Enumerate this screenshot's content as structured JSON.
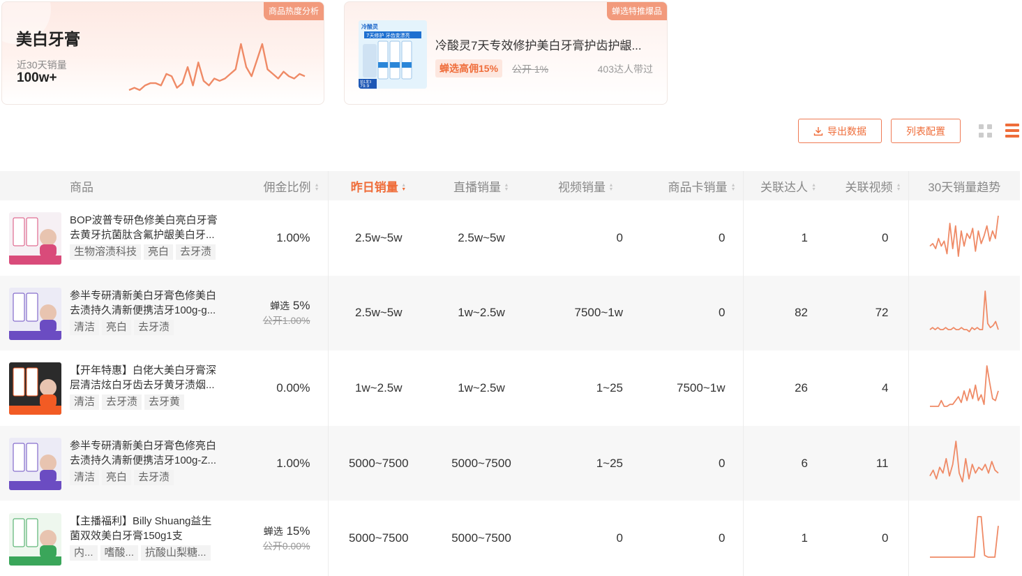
{
  "hot_card": {
    "corner_label": "商品热度分析",
    "title": "美白牙膏",
    "sales_label": "近30天销量",
    "sales_value": "100w+",
    "sparkline": [
      2,
      3,
      2,
      4,
      5,
      5,
      4,
      9,
      8,
      3,
      5,
      12,
      4,
      14,
      6,
      4,
      7,
      6,
      7,
      9,
      11,
      22,
      12,
      8,
      15,
      22,
      11,
      9,
      7,
      10,
      8,
      7,
      9,
      8
    ]
  },
  "featured_card": {
    "corner_label": "蝉选特推爆品",
    "product_name": "冷酸灵7天专效修护美白牙膏护齿护龈...",
    "commission_tag": "蝉选高佣15%",
    "public_commission": "公开 1%",
    "promoter_count": "403达人带过",
    "image_texts": [
      "冷酸灵",
      "7天修护 牙齿变漂亮",
      "拍1发3",
      "79.9"
    ]
  },
  "toolbar": {
    "export_label": "导出数据",
    "config_label": "列表配置"
  },
  "table": {
    "headers": [
      "商品",
      "佣金比例",
      "昨日销量",
      "直播销量",
      "视频销量",
      "商品卡销量",
      "关联达人",
      "关联视频",
      "30天销量趋势"
    ],
    "rows": [
      {
        "title": "BOP波普专研色修美白亮白牙膏去黄牙抗菌肽含氟护龈美白牙...",
        "tags": [
          "生物溶渍科技",
          "亮白",
          "去牙渍"
        ],
        "commission_label": "",
        "commission": "1.00%",
        "commission_old": "",
        "yesterday": "2.5w~5w",
        "live": "2.5w~5w",
        "video": "0",
        "card": "0",
        "influencers": "1",
        "videos": "0",
        "trend": [
          6,
          7,
          5,
          9,
          6,
          8,
          3,
          15,
          5,
          14,
          2,
          12,
          6,
          11,
          9,
          13,
          4,
          12,
          7,
          10,
          14,
          8,
          12,
          9,
          18
        ]
      },
      {
        "title": "参半专研清新美白牙膏色修美白去渍持久清新便携洁牙100g-g...",
        "tags": [
          "清洁",
          "亮白",
          "去牙渍"
        ],
        "commission_label": "蝉选",
        "commission": "5%",
        "commission_old": "公开1.00%",
        "yesterday": "2.5w~5w",
        "live": "1w~2.5w",
        "video": "7500~1w",
        "card": "0",
        "influencers": "82",
        "videos": "72",
        "trend": [
          3,
          4,
          3,
          4,
          3,
          3,
          4,
          3,
          3,
          4,
          3,
          3,
          4,
          3,
          3,
          2,
          4,
          3,
          4,
          3,
          3,
          22,
          6,
          4,
          5,
          7,
          3
        ]
      },
      {
        "title": "【开年特惠】白佬大美白牙膏深层清洁炫白牙齿去牙黄牙渍烟...",
        "tags": [
          "清洁",
          "去牙渍",
          "去牙黄"
        ],
        "commission_label": "",
        "commission": "0.00%",
        "commission_old": "",
        "yesterday": "1w~2.5w",
        "live": "1w~2.5w",
        "video": "1~25",
        "card": "7500~1w",
        "influencers": "26",
        "videos": "4",
        "trend": [
          0,
          0,
          0,
          0,
          3,
          0,
          0,
          1,
          1,
          3,
          5,
          2,
          8,
          3,
          9,
          4,
          11,
          3,
          6,
          1,
          21,
          12,
          4,
          3,
          8
        ]
      },
      {
        "title": "参半专研清新美白牙膏色修亮白去渍持久清新便携洁牙100g-Z...",
        "tags": [
          "清洁",
          "亮白",
          "去牙渍"
        ],
        "commission_label": "",
        "commission": "1.00%",
        "commission_old": "",
        "yesterday": "5000~7500",
        "live": "5000~7500",
        "video": "1~25",
        "card": "0",
        "influencers": "6",
        "videos": "11",
        "trend": [
          6,
          8,
          5,
          9,
          7,
          12,
          6,
          10,
          18,
          7,
          4,
          12,
          5,
          10,
          7,
          9,
          8,
          10,
          7,
          11,
          8,
          7
        ]
      },
      {
        "title": "【主播福利】Billy Shuang益生菌双效美白牙膏150g1支",
        "tags": [
          "内...",
          "嗜酸...",
          "抗酸山梨糖..."
        ],
        "commission_label": "蝉选",
        "commission": "15%",
        "commission_old": "公开0.00%",
        "yesterday": "5000~7500",
        "live": "5000~7500",
        "video": "0",
        "card": "0",
        "influencers": "1",
        "videos": "0",
        "trend": [
          0,
          0,
          0,
          0,
          0,
          0,
          0,
          0,
          0,
          0,
          0,
          0,
          0,
          0,
          22,
          22,
          1,
          0,
          0,
          0,
          17
        ]
      }
    ]
  },
  "colors": {
    "accent": "#ef6d3a",
    "line": "#ef8a66",
    "corner": "#f29a7c"
  }
}
